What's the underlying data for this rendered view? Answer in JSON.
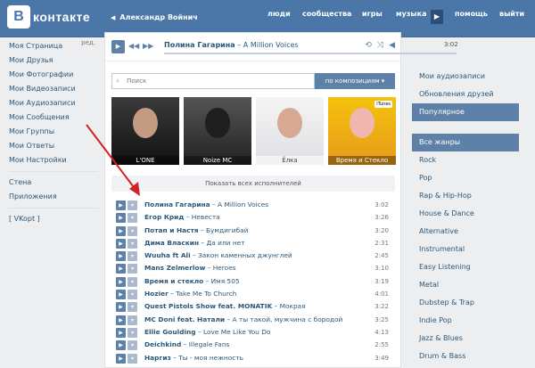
{
  "header": {
    "logo_letter": "В",
    "logo_text": "контакте",
    "user_back_icon": "chevron-left-icon",
    "user_name": "Александр Войнич",
    "nav": {
      "people": "люди",
      "communities": "сообщества",
      "games": "игры",
      "music": "музыка",
      "play_icon": "play-icon",
      "help": "помощь",
      "logout": "выйти"
    }
  },
  "left_menu": {
    "items": [
      "Моя Страница",
      "Мои Друзья",
      "Мои Фотографии",
      "Мои Видеозаписи",
      "Мои Аудиозаписи",
      "Мои Сообщения",
      "Мои Группы",
      "Мои Ответы",
      "Мои Настройки"
    ],
    "edit_label": "ред.",
    "extra": [
      "Стена",
      "Приложения"
    ],
    "vkopt": "[ VKopt ]"
  },
  "player": {
    "artist": "Полина Гагарина",
    "separator": " – ",
    "title": "A Million Voices",
    "time": "3:02",
    "progress": 0.0
  },
  "search": {
    "placeholder": "Поиск",
    "filter_label": "по композициям ▾"
  },
  "artists": [
    {
      "name": "L'ONE"
    },
    {
      "name": "Noize MC"
    },
    {
      "name": "Ёлка"
    },
    {
      "name": "Время и Стекло",
      "badge": "iTunes"
    }
  ],
  "show_all": "Показать всех исполнителей",
  "tracks": [
    {
      "artist": "Полина Гагарина",
      "title": "A Million Voices",
      "duration": "3:02"
    },
    {
      "artist": "Егор Крид",
      "title": "Невеста",
      "duration": "3:26"
    },
    {
      "artist": "Потап и Настя",
      "title": "Бумдигибай",
      "duration": "3:20"
    },
    {
      "artist": "Дима Власкин",
      "title": "Да или нет",
      "duration": "2:31"
    },
    {
      "artist": "Wuuha ft Ali",
      "title": "Закон каменных джунглей",
      "duration": "2:45"
    },
    {
      "artist": "Mans Zelmerlow",
      "title": "Heroes",
      "duration": "3:10"
    },
    {
      "artist": "Время и стекло",
      "title": "Имя 505",
      "duration": "3:19"
    },
    {
      "artist": "Hozier",
      "title": "Take Me To Church",
      "duration": "4:01"
    },
    {
      "artist": "Quest Pistols Show feat. MONATIK",
      "title": "Мокрая",
      "duration": "3:22"
    },
    {
      "artist": "MC Doni feat. Натали",
      "title": "А ты такой, мужчина с бородой",
      "duration": "3:25"
    },
    {
      "artist": "Ellie Goulding",
      "title": "Love Me Like You Do",
      "duration": "4:13"
    },
    {
      "artist": "Deichkind",
      "title": "Illegale Fans",
      "duration": "2:55"
    },
    {
      "artist": "Наргиз",
      "title": "Ты - моя нежность",
      "duration": "3:49"
    }
  ],
  "right_menu": {
    "items": [
      "Мои аудиозаписи",
      "Обновления друзей",
      "Популярное"
    ],
    "active": "Популярное",
    "genres": [
      "Все жанры",
      "Rock",
      "Pop",
      "Rap & Hip-Hop",
      "House & Dance",
      "Alternative",
      "Instrumental",
      "Easy Listening",
      "Metal",
      "Dubstep & Trap",
      "Indie Pop",
      "Jazz & Blues",
      "Drum & Bass"
    ]
  },
  "colors": {
    "header": "#4a76a8",
    "accent": "#5e81a8",
    "link": "#2b587a",
    "arrow": "#d32222"
  }
}
